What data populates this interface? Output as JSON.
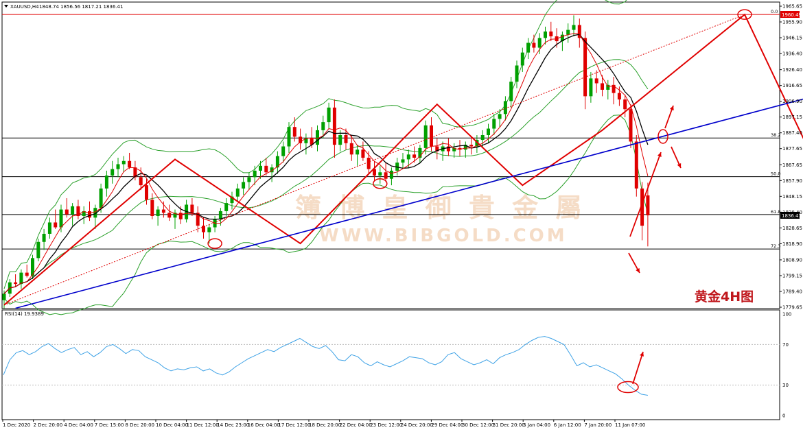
{
  "header": {
    "symbol": "XAUUSD,H4",
    "ohlc": "1848.74 1856.56 1817.21 1836.41",
    "rsi_label": "RSI(14) 19.9389"
  },
  "watermark": {
    "chinese": "簿 博 皇 御 貴 金 屬",
    "latin": "WWW.BIBGOLD.COM"
  },
  "annotation": "黄金4H图",
  "price_tags": {
    "top_line": "1960.49",
    "current": "1836.41"
  },
  "fib_labels": [
    {
      "label": "0.0",
      "price": 1960.49
    },
    {
      "label": "38.2",
      "price": 1884.2
    },
    {
      "label": "50.0",
      "price": 1860.3
    },
    {
      "label": "61.8",
      "price": 1836.9
    },
    {
      "label": "72.3",
      "price": 1815.6
    }
  ],
  "colors": {
    "candle_up": "#00a000",
    "candle_down": "#e00000",
    "bollinger": "#2aa02a",
    "ma_black": "#000000",
    "zigzag": "#e00000",
    "trendline": "#0000cc",
    "rsi": "#3ea2e6",
    "annotation": "#c0171c"
  },
  "chart_data": [
    {
      "type": "candlestick",
      "symbol": "XAUUSD",
      "timeframe": "H4",
      "ylim": [
        1779.65,
        1965.65
      ],
      "y_ticks": [
        "1965.65",
        "1955.90",
        "1946.15",
        "1936.40",
        "1926.40",
        "1916.65",
        "1906.90",
        "1897.15",
        "1887.40",
        "1877.65",
        "1867.65",
        "1857.90",
        "1848.15",
        "1838.40",
        "1828.65",
        "1818.90",
        "1808.90",
        "1799.15",
        "1789.40",
        "1779.65"
      ],
      "x_ticks": [
        "1 Dec 2020",
        "2 Dec 20:00",
        "4 Dec 04:00",
        "7 Dec 15:00",
        "8 Dec 20:00",
        "10 Dec 04:00",
        "11 Dec 12:00",
        "14 Dec 23:00",
        "16 Dec 04:00",
        "17 Dec 12:00",
        "18 Dec 20:00",
        "22 Dec 04:00",
        "23 Dec 12:00",
        "24 Dec 20:00",
        "29 Dec 04:00",
        "30 Dec 12:00",
        "31 Dec 20:00",
        "5 Jan 04:00",
        "6 Jan 12:00",
        "7 Jan 20:00",
        "11 Jan 07:00"
      ],
      "zigzag_points": [
        [
          0,
          1781
        ],
        [
          30,
          1871
        ],
        [
          52,
          1819
        ],
        [
          76,
          1905
        ],
        [
          91,
          1855
        ],
        [
          105,
          1889
        ],
        [
          130,
          1960.49
        ],
        [
          143,
          1864
        ]
      ],
      "trendline_points": [
        [
          2,
          1779
        ],
        [
          155,
          1922
        ]
      ],
      "candles": [
        [
          1784,
          1790,
          1779,
          1788
        ],
        [
          1788,
          1797,
          1786,
          1795
        ],
        [
          1795,
          1800,
          1792,
          1794
        ],
        [
          1794,
          1803,
          1791,
          1801
        ],
        [
          1801,
          1806,
          1798,
          1799
        ],
        [
          1799,
          1812,
          1797,
          1810
        ],
        [
          1810,
          1822,
          1808,
          1820
        ],
        [
          1820,
          1828,
          1815,
          1825
        ],
        [
          1825,
          1835,
          1822,
          1832
        ],
        [
          1832,
          1840,
          1828,
          1829
        ],
        [
          1829,
          1843,
          1826,
          1840
        ],
        [
          1840,
          1847,
          1835,
          1837
        ],
        [
          1837,
          1844,
          1830,
          1842
        ],
        [
          1842,
          1846,
          1834,
          1836
        ],
        [
          1836,
          1842,
          1831,
          1839
        ],
        [
          1839,
          1845,
          1833,
          1835
        ],
        [
          1835,
          1843,
          1828,
          1841
        ],
        [
          1841,
          1856,
          1838,
          1853
        ],
        [
          1853,
          1864,
          1848,
          1861
        ],
        [
          1861,
          1870,
          1856,
          1865
        ],
        [
          1865,
          1872,
          1860,
          1868
        ],
        [
          1868,
          1873,
          1863,
          1870
        ],
        [
          1870,
          1875,
          1865,
          1866
        ],
        [
          1866,
          1870,
          1858,
          1860
        ],
        [
          1860,
          1866,
          1852,
          1855
        ],
        [
          1855,
          1859,
          1843,
          1846
        ],
        [
          1846,
          1850,
          1834,
          1836
        ],
        [
          1836,
          1842,
          1830,
          1840
        ],
        [
          1840,
          1845,
          1835,
          1838
        ],
        [
          1838,
          1843,
          1833,
          1835
        ],
        [
          1835,
          1840,
          1828,
          1838
        ],
        [
          1838,
          1842,
          1831,
          1834
        ],
        [
          1834,
          1846,
          1832,
          1843
        ],
        [
          1843,
          1847,
          1836,
          1838
        ],
        [
          1838,
          1842,
          1826,
          1830
        ],
        [
          1830,
          1835,
          1822,
          1826
        ],
        [
          1826,
          1831,
          1819,
          1829
        ],
        [
          1829,
          1836,
          1826,
          1834
        ],
        [
          1834,
          1841,
          1830,
          1839
        ],
        [
          1839,
          1847,
          1836,
          1844
        ],
        [
          1844,
          1851,
          1840,
          1848
        ],
        [
          1848,
          1856,
          1845,
          1853
        ],
        [
          1853,
          1860,
          1849,
          1857
        ],
        [
          1857,
          1863,
          1852,
          1860
        ],
        [
          1860,
          1867,
          1855,
          1864
        ],
        [
          1864,
          1870,
          1859,
          1867
        ],
        [
          1867,
          1872,
          1861,
          1863
        ],
        [
          1863,
          1868,
          1857,
          1866
        ],
        [
          1866,
          1876,
          1862,
          1873
        ],
        [
          1873,
          1882,
          1869,
          1879
        ],
        [
          1879,
          1894,
          1875,
          1891
        ],
        [
          1891,
          1897,
          1882,
          1885
        ],
        [
          1885,
          1890,
          1877,
          1881
        ],
        [
          1881,
          1887,
          1874,
          1884
        ],
        [
          1884,
          1891,
          1878,
          1880
        ],
        [
          1880,
          1892,
          1876,
          1889
        ],
        [
          1889,
          1898,
          1884,
          1894
        ],
        [
          1894,
          1906,
          1890,
          1903
        ],
        [
          1903,
          1908,
          1872,
          1880
        ],
        [
          1880,
          1889,
          1876,
          1886
        ],
        [
          1886,
          1890,
          1877,
          1881
        ],
        [
          1881,
          1886,
          1870,
          1874
        ],
        [
          1874,
          1880,
          1867,
          1877
        ],
        [
          1877,
          1882,
          1870,
          1872
        ],
        [
          1872,
          1876,
          1862,
          1865
        ],
        [
          1865,
          1870,
          1858,
          1861
        ],
        [
          1861,
          1867,
          1856,
          1863
        ],
        [
          1863,
          1869,
          1857,
          1859
        ],
        [
          1859,
          1866,
          1855,
          1864
        ],
        [
          1864,
          1872,
          1861,
          1869
        ],
        [
          1869,
          1875,
          1865,
          1871
        ],
        [
          1871,
          1877,
          1866,
          1874
        ],
        [
          1874,
          1879,
          1869,
          1872
        ],
        [
          1872,
          1880,
          1869,
          1878
        ],
        [
          1878,
          1895,
          1874,
          1892
        ],
        [
          1892,
          1897,
          1876,
          1879
        ],
        [
          1879,
          1884,
          1871,
          1876
        ],
        [
          1876,
          1882,
          1870,
          1879
        ],
        [
          1879,
          1884,
          1873,
          1876
        ],
        [
          1876,
          1881,
          1872,
          1878
        ],
        [
          1878,
          1883,
          1873,
          1877
        ],
        [
          1877,
          1882,
          1872,
          1880
        ],
        [
          1880,
          1885,
          1874,
          1879
        ],
        [
          1879,
          1886,
          1875,
          1883
        ],
        [
          1883,
          1889,
          1878,
          1886
        ],
        [
          1886,
          1893,
          1881,
          1890
        ],
        [
          1890,
          1899,
          1886,
          1896
        ],
        [
          1896,
          1902,
          1891,
          1899
        ],
        [
          1899,
          1910,
          1895,
          1907
        ],
        [
          1907,
          1922,
          1903,
          1919
        ],
        [
          1919,
          1932,
          1915,
          1929
        ],
        [
          1929,
          1940,
          1925,
          1937
        ],
        [
          1937,
          1946,
          1933,
          1943
        ],
        [
          1943,
          1948,
          1937,
          1940
        ],
        [
          1940,
          1949,
          1936,
          1946
        ],
        [
          1946,
          1953,
          1942,
          1950
        ],
        [
          1950,
          1956,
          1944,
          1947
        ],
        [
          1947,
          1952,
          1940,
          1944
        ],
        [
          1944,
          1950,
          1938,
          1948
        ],
        [
          1948,
          1955,
          1943,
          1951
        ],
        [
          1951,
          1960,
          1947,
          1954
        ],
        [
          1954,
          1958,
          1940,
          1946
        ],
        [
          1946,
          1950,
          1902,
          1910
        ],
        [
          1910,
          1925,
          1906,
          1921
        ],
        [
          1921,
          1926,
          1912,
          1918
        ],
        [
          1918,
          1923,
          1910,
          1914
        ],
        [
          1914,
          1920,
          1908,
          1917
        ],
        [
          1917,
          1922,
          1905,
          1912
        ],
        [
          1912,
          1916,
          1904,
          1908
        ],
        [
          1908,
          1911,
          1897,
          1902
        ],
        [
          1902,
          1905,
          1878,
          1882
        ],
        [
          1882,
          1886,
          1848,
          1853
        ],
        [
          1853,
          1857,
          1821,
          1830
        ],
        [
          1848.74,
          1856.56,
          1817.21,
          1836.41
        ]
      ],
      "x_start": 6,
      "x_step": 8.3
    },
    {
      "type": "line",
      "title": "RSI(14) 19.9389",
      "ylim": [
        0,
        100
      ],
      "y_ticks": [
        "100",
        "70",
        "30",
        "0"
      ],
      "levels": [
        70,
        30
      ],
      "values": [
        40,
        55,
        62,
        64,
        60,
        63,
        68,
        71,
        66,
        62,
        65,
        67,
        60,
        63,
        58,
        62,
        68,
        70,
        66,
        61,
        65,
        64,
        58,
        55,
        52,
        47,
        44,
        46,
        45,
        47,
        48,
        44,
        46,
        42,
        40,
        43,
        48,
        52,
        56,
        59,
        62,
        65,
        63,
        67,
        70,
        73,
        76,
        72,
        68,
        66,
        69,
        63,
        55,
        54,
        60,
        58,
        52,
        49,
        53,
        50,
        48,
        51,
        54,
        58,
        57,
        56,
        52,
        50,
        53,
        60,
        62,
        56,
        53,
        50,
        52,
        55,
        51,
        57,
        60,
        62,
        65,
        70,
        74,
        77,
        78,
        76,
        73,
        70,
        60,
        49,
        52,
        48,
        50,
        47,
        44,
        41,
        36,
        30,
        25,
        21,
        19.94
      ]
    }
  ]
}
